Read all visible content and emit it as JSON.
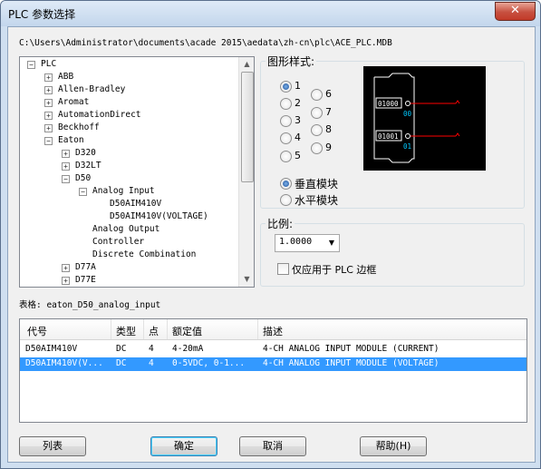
{
  "window": {
    "title": "PLC 参数选择",
    "close_glyph": "✕"
  },
  "path": "C:\\Users\\Administrator\\documents\\acade 2015\\aedata\\zh-cn\\plc\\ACE_PLC.MDB",
  "tree": {
    "items": [
      {
        "label": "PLC",
        "expander": "−"
      },
      {
        "label": "ABB",
        "expander": "+"
      },
      {
        "label": "Allen-Bradley",
        "expander": "+"
      },
      {
        "label": "Aromat",
        "expander": "+"
      },
      {
        "label": "AutomationDirect",
        "expander": "+"
      },
      {
        "label": "Beckhoff",
        "expander": "+"
      },
      {
        "label": "Eaton",
        "expander": "−"
      },
      {
        "label": "D320",
        "expander": "+"
      },
      {
        "label": "D32LT",
        "expander": "+"
      },
      {
        "label": "D50",
        "expander": "−"
      },
      {
        "label": "Analog Input",
        "expander": "−"
      },
      {
        "label": "D50AIM410V",
        "expander": ""
      },
      {
        "label": "D50AIM410V(VOLTAGE)",
        "expander": ""
      },
      {
        "label": "Analog Output",
        "expander": ""
      },
      {
        "label": "Controller",
        "expander": ""
      },
      {
        "label": "Discrete Combination",
        "expander": ""
      },
      {
        "label": "D77A",
        "expander": "+"
      },
      {
        "label": "D77E",
        "expander": "+"
      }
    ]
  },
  "graphic_style": {
    "label": "图形样式:",
    "selected": "1",
    "options": [
      "1",
      "2",
      "3",
      "4",
      "5",
      "6",
      "7",
      "8",
      "9"
    ]
  },
  "preview": {
    "address_1": "01000",
    "address_2": "01001",
    "point_1": "00",
    "point_2": "01"
  },
  "orientation": {
    "selected": "垂直模块",
    "options": [
      "垂直模块",
      "水平模块"
    ]
  },
  "scale": {
    "label": "比例:",
    "value": "1.0000",
    "plc_border_only_label": "仅应用于 PLC 边框",
    "plc_border_only_checked": false
  },
  "table_label": "表格: eaton_D50_analog_input",
  "table": {
    "columns": [
      "代号",
      "类型",
      "点",
      "额定值",
      "描述"
    ],
    "rows": [
      {
        "code": "D50AIM410V",
        "type": "DC",
        "points": "4",
        "rating": "4-20mA",
        "desc": "4-CH ANALOG INPUT MODULE (CURRENT)",
        "selected": false
      },
      {
        "code": "D50AIM410V(V...",
        "type": "DC",
        "points": "4",
        "rating": "0-5VDC, 0-1...",
        "desc": "4-CH ANALOG INPUT MODULE (VOLTAGE)",
        "selected": true
      }
    ]
  },
  "buttons": {
    "list": "列表",
    "ok": "确定",
    "cancel": "取消",
    "help": "帮助(H)"
  },
  "colors": {
    "selection": "#3399ff",
    "preview_bg": "#000000",
    "preview_wire": "#ff0000",
    "preview_text": "#00c8ff"
  },
  "icons": {
    "close": "close-icon",
    "expand": "plus-box-icon",
    "collapse": "minus-box-icon",
    "dropdown": "chevron-down-icon"
  }
}
